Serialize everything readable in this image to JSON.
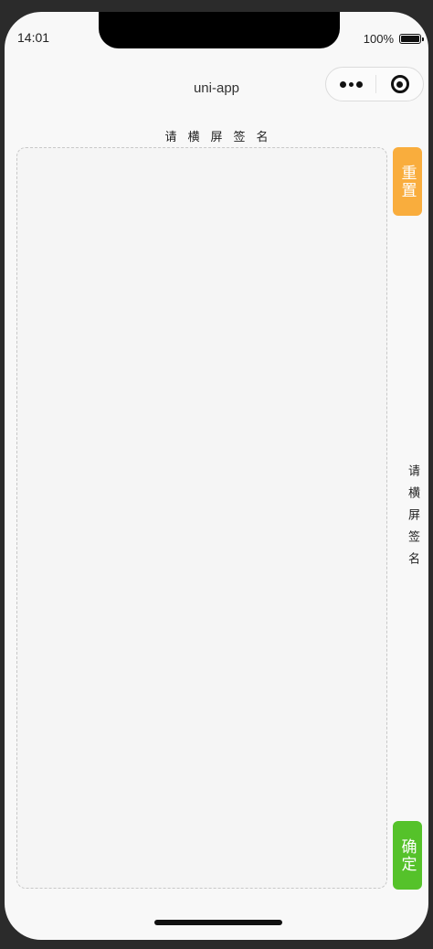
{
  "status_bar": {
    "time": "14:01",
    "battery_percent": "100%"
  },
  "nav": {
    "title": "uni-app"
  },
  "capsule": {
    "more_icon": "more-dots-icon",
    "close_icon": "target-close-icon"
  },
  "signature": {
    "hint_top": "请横屏签名",
    "hint_side": "请横屏签名",
    "reset_label": "重置",
    "confirm_label": "确定"
  },
  "colors": {
    "reset": "#f9ad3d",
    "confirm": "#55c22a",
    "background": "#f8f8f8"
  }
}
